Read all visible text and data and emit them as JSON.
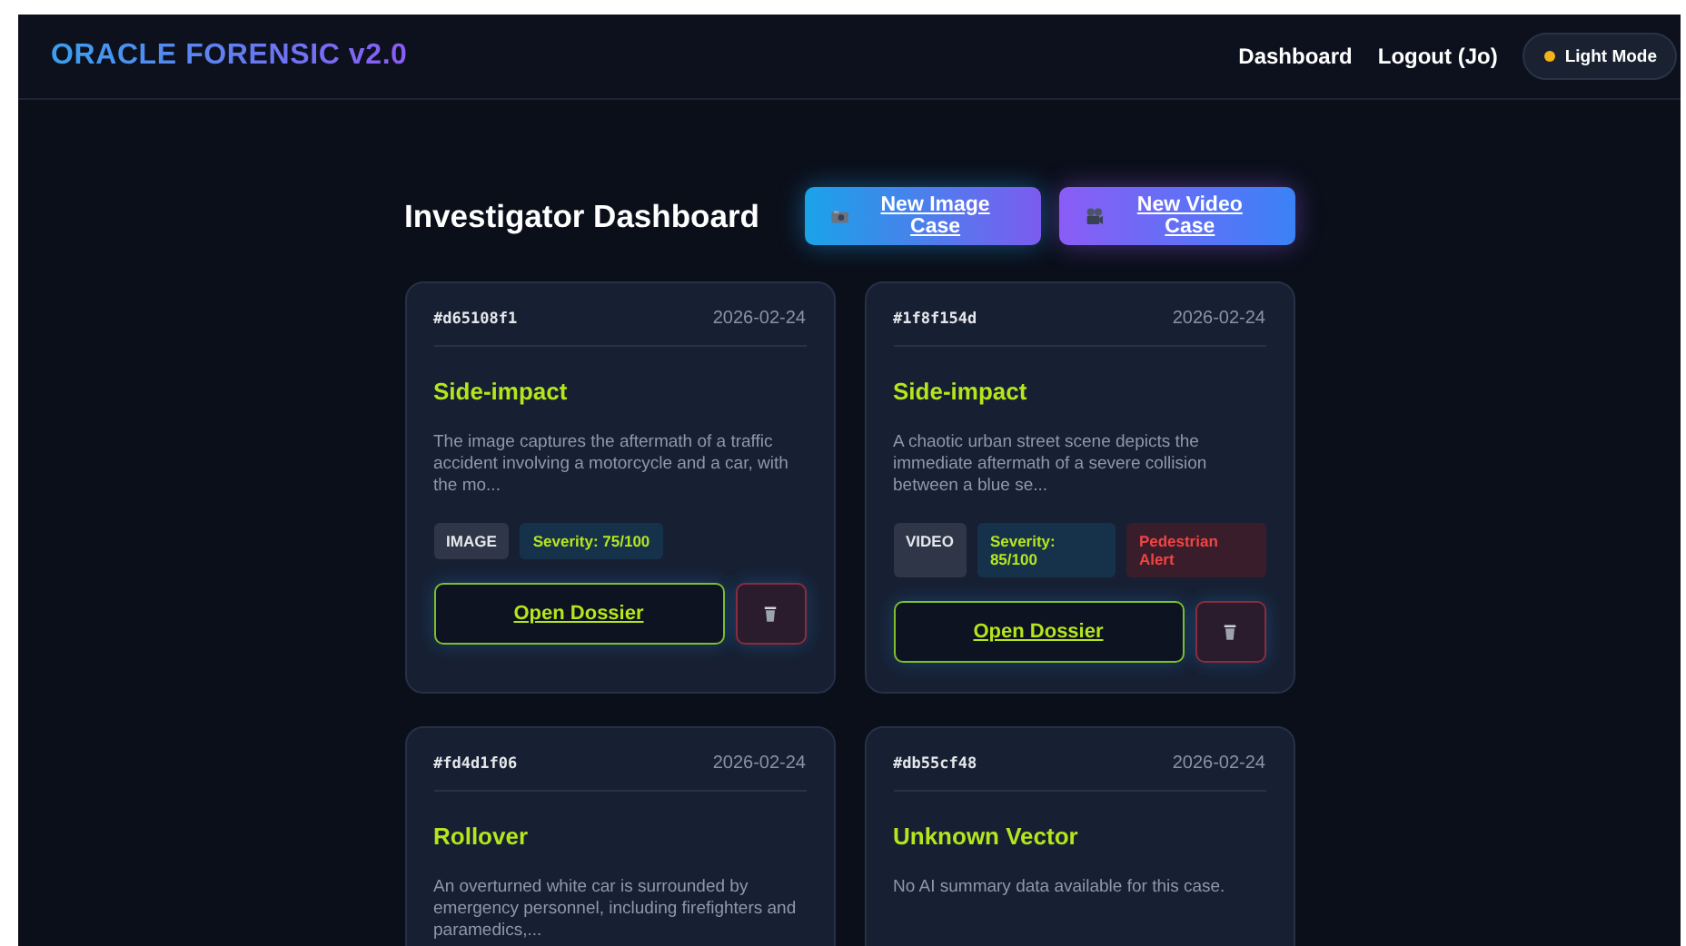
{
  "header": {
    "brand": "ORACLE FORENSIC v2.0",
    "nav": [
      "Dashboard",
      "Logout (Jo)"
    ],
    "theme_button": "Light Mode"
  },
  "dashboard": {
    "title": "Investigator Dashboard",
    "actions": [
      {
        "label": "New Image Case",
        "kind": "image"
      },
      {
        "label": "New Video Case",
        "kind": "video"
      }
    ]
  },
  "cases": [
    {
      "id": "#d65108f1",
      "date": "2026-02-24",
      "title": "Side-impact",
      "summary": "The image captures the aftermath of a traffic accident involving a motorcycle and a car, with the mo...",
      "tags": [
        {
          "label": "IMAGE",
          "kind": "type"
        },
        {
          "label": "Severity: 75/100",
          "kind": "severity"
        }
      ],
      "open": "Open Dossier"
    },
    {
      "id": "#1f8f154d",
      "date": "2026-02-24",
      "title": "Side-impact",
      "summary": "A chaotic urban street scene depicts the immediate aftermath of a severe collision between a blue se...",
      "tags": [
        {
          "label": "VIDEO",
          "kind": "type"
        },
        {
          "label": "Severity: 85/100",
          "kind": "severity"
        },
        {
          "label": "Pedestrian Alert",
          "kind": "alert"
        }
      ],
      "open": "Open Dossier"
    },
    {
      "id": "#fd4d1f06",
      "date": "2026-02-24",
      "title": "Rollover",
      "summary": "An overturned white car is surrounded by emergency personnel, including firefighters and paramedics,..."
    },
    {
      "id": "#db55cf48",
      "date": "2026-02-24",
      "title": "Unknown Vector",
      "summary": "No AI summary data available for this case."
    }
  ]
}
